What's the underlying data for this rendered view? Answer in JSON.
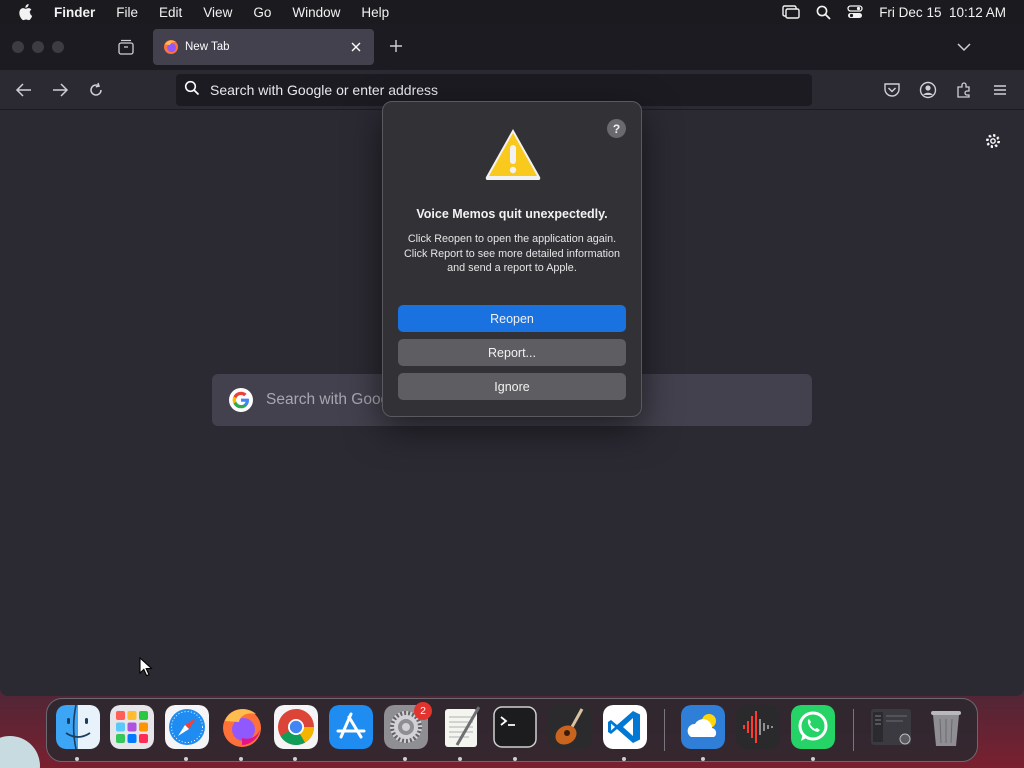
{
  "menubar": {
    "app_name": "Finder",
    "items": [
      "File",
      "Edit",
      "View",
      "Go",
      "Window",
      "Help"
    ],
    "clock": "Fri Dec 15  10:12 AM"
  },
  "browser": {
    "tab_title": "New Tab",
    "url_placeholder": "Search with Google or enter address",
    "search_placeholder": "Search with Goog"
  },
  "alert": {
    "help_glyph": "?",
    "title": "Voice Memos quit unexpectedly.",
    "message": "Click Reopen to open the application again. Click Report to see more detailed information and send a report to Apple.",
    "buttons": {
      "reopen": "Reopen",
      "report": "Report...",
      "ignore": "Ignore"
    }
  },
  "dock": {
    "apps": [
      "finder-icon",
      "launchpad-icon",
      "safari-icon",
      "firefox-icon",
      "chrome-icon",
      "app-store-icon",
      "system-settings-icon",
      "textedit-icon",
      "terminal-icon",
      "garageband-icon",
      "vscode-icon",
      "weather-icon",
      "voice-memos-icon",
      "whatsapp-icon",
      "downloads-stack-icon",
      "trash-icon"
    ],
    "settings_badge": "2"
  },
  "colors": {
    "accent": "#1a72e0",
    "window_bg": "#2b2a33",
    "tab_bg": "#42414d",
    "badge": "#e3332f"
  }
}
